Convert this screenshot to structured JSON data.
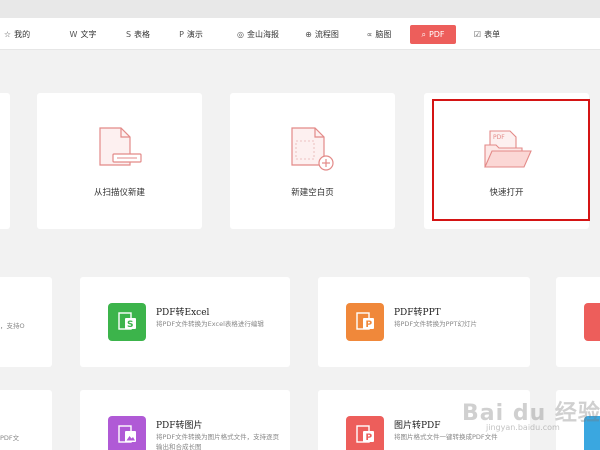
{
  "tabs": [
    {
      "icon": "☆",
      "label": "我的"
    },
    {
      "icon": "W",
      "label": "文字"
    },
    {
      "icon": "S",
      "label": "表格"
    },
    {
      "icon": "P",
      "label": "演示"
    },
    {
      "icon": "◎",
      "label": "金山海报"
    },
    {
      "icon": "⊕",
      "label": "流程图"
    },
    {
      "icon": "∝",
      "label": "脑图"
    },
    {
      "icon": "⌕",
      "label": "PDF"
    },
    {
      "icon": "☑",
      "label": "表单"
    }
  ],
  "active_tab": "PDF",
  "create_cards": [
    {
      "label": "从扫描仪新建"
    },
    {
      "label": "新建空白页"
    },
    {
      "label": "快速打开",
      "icon_text": "PDF"
    }
  ],
  "tools": [
    {
      "title": "PDF转Excel",
      "desc": "将PDF文件转换为Excel表格进行编辑",
      "icon_letter": "S",
      "color": "#3cb44b"
    },
    {
      "title": "PDF转PPT",
      "desc": "将PDF文件转换为PPT幻灯片",
      "icon_letter": "P",
      "color": "#f0883a"
    },
    {
      "title": "PDF转图片",
      "desc": "将PDF文件转换为图片格式文件，支持逐页输出和合成长图",
      "icon_letter": "▲",
      "color": "#b05ad6"
    },
    {
      "title": "图片转PDF",
      "desc": "将图片格式文件一键转换成PDF文件",
      "icon_letter": "P",
      "color": "#ed5e5b"
    }
  ],
  "partial_left": [
    {
      "text": "，支持O"
    },
    {
      "text": "PDF文"
    }
  ],
  "watermark": {
    "main": "Bai du 经验",
    "sub": "jingyan.baidu.com"
  }
}
